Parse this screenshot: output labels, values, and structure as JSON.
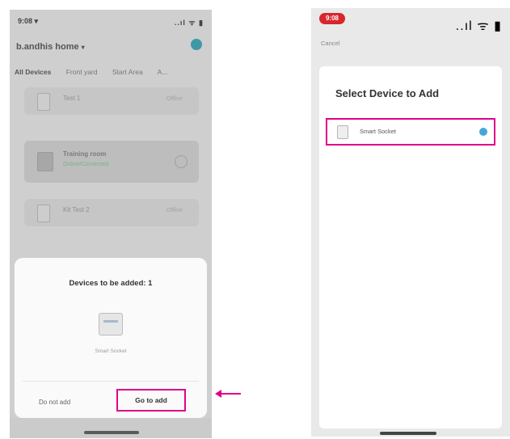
{
  "left_phone": {
    "status_time": "9:08 ▾",
    "status_icons": "..ıl ᯤ ▮",
    "home_title": "b.andhis home",
    "tabs": [
      "All Devices",
      "Front yard",
      "Start Area",
      "A..."
    ],
    "devices": [
      {
        "name": "Test 1",
        "status": "Offline"
      },
      {
        "name": "Training room",
        "subtitle": "Online/Connected",
        "status": ""
      },
      {
        "name": "Kit Test 2",
        "status": "Offline"
      }
    ],
    "sheet": {
      "title": "Devices to be added: 1",
      "device_label": "Smart Socket",
      "do_not_add": "Do not add",
      "go_to_add": "Go to add"
    }
  },
  "right_phone": {
    "status_time": "9:08",
    "status_icons": "..ıl ᯤ ▮",
    "cancel": "Cancel",
    "title": "Select Device to Add",
    "device_row_label": "Smart Socket"
  },
  "colors": {
    "highlight": "#e0008c",
    "accent_blue": "#45a7d6",
    "status_pill": "#d8262c"
  }
}
